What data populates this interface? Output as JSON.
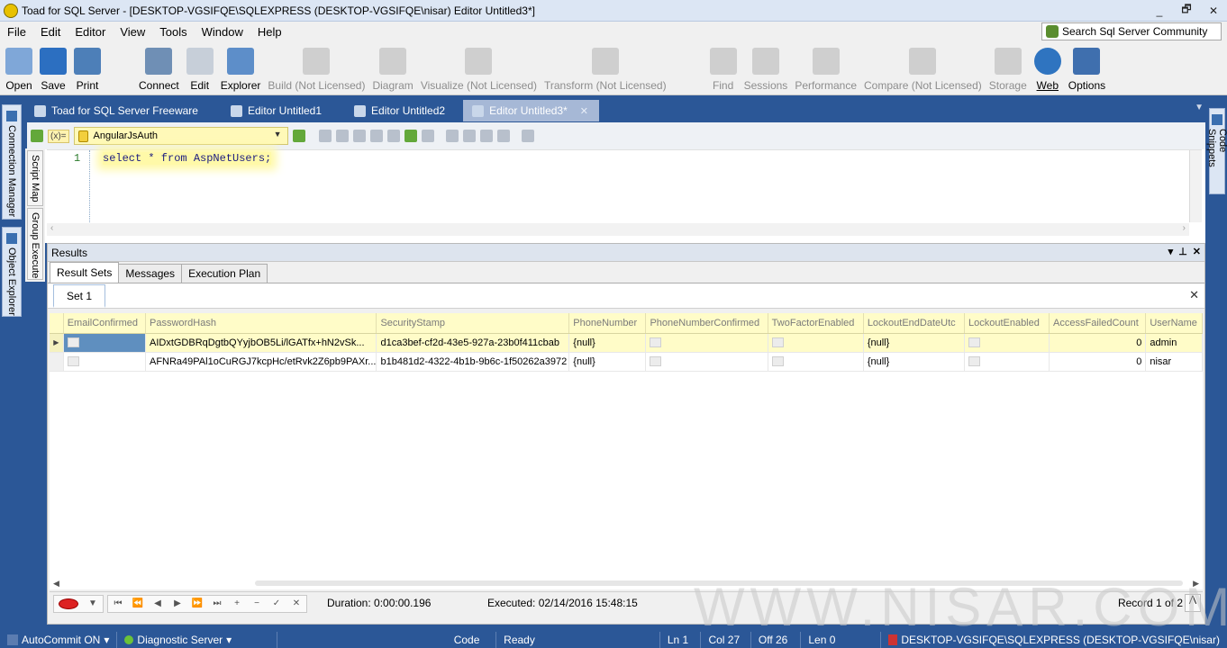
{
  "window": {
    "title": "Toad for SQL Server - [DESKTOP-VGSIFQE\\SQLEXPRESS (DESKTOP-VGSIFQE\\nisar) Editor Untitled3*]",
    "controls": [
      "_",
      "🗗",
      "✕"
    ]
  },
  "menu": {
    "items": [
      "File",
      "Edit",
      "Editor",
      "View",
      "Tools",
      "Window",
      "Help"
    ],
    "search_community": "Search Sql Server Community"
  },
  "toolbar": {
    "buttons": [
      {
        "label": "Open",
        "icon": "open-folder-icon",
        "enabled": true
      },
      {
        "label": "Save",
        "icon": "save-disk-icon",
        "enabled": true
      },
      {
        "label": "Print",
        "icon": "printer-icon",
        "enabled": true
      },
      {
        "label": "Connect",
        "icon": "plug-icon",
        "enabled": true
      },
      {
        "label": "Edit",
        "icon": "edit-document-icon",
        "enabled": true
      },
      {
        "label": "Explorer",
        "icon": "database-explorer-icon",
        "enabled": true
      },
      {
        "label": "Build (Not Licensed)",
        "icon": "build-icon",
        "enabled": false
      },
      {
        "label": "Diagram",
        "icon": "diagram-icon",
        "enabled": false
      },
      {
        "label": "Visualize (Not Licensed)",
        "icon": "visualize-icon",
        "enabled": false
      },
      {
        "label": "Transform (Not Licensed)",
        "icon": "transform-icon",
        "enabled": false
      },
      {
        "label": "Find",
        "icon": "find-icon",
        "enabled": false
      },
      {
        "label": "Sessions",
        "icon": "sessions-icon",
        "enabled": false
      },
      {
        "label": "Performance",
        "icon": "performance-icon",
        "enabled": false
      },
      {
        "label": "Compare (Not Licensed)",
        "icon": "compare-icon",
        "enabled": false
      },
      {
        "label": "Storage",
        "icon": "storage-icon",
        "enabled": false
      },
      {
        "label": "Web",
        "icon": "globe-icon",
        "enabled": true
      },
      {
        "label": "Options",
        "icon": "options-icon",
        "enabled": true
      }
    ]
  },
  "doc_tabs": [
    {
      "label": "Toad for SQL Server Freeware",
      "active": false
    },
    {
      "label": "Editor Untitled1",
      "active": false
    },
    {
      "label": "Editor Untitled2",
      "active": false
    },
    {
      "label": "Editor Untitled3*",
      "active": true
    }
  ],
  "side_panels": {
    "left": [
      "Connection Manager",
      "Object Explorer"
    ],
    "script": [
      "Script Map",
      "Group Execute"
    ],
    "right": [
      "Code Snippets"
    ]
  },
  "editor": {
    "connection": "AngularJsAuth",
    "variable_button": "(x)=",
    "line_number": "1",
    "sql": "select * from AspNetUsers;"
  },
  "results": {
    "panel_title": "Results",
    "tabs": [
      "Result Sets",
      "Messages",
      "Execution Plan"
    ],
    "active_tab": "Result Sets",
    "set_tab": "Set 1",
    "columns": [
      "EmailConfirmed",
      "PasswordHash",
      "SecurityStamp",
      "PhoneNumber",
      "PhoneNumberConfirmed",
      "TwoFactorEnabled",
      "LockoutEndDateUtc",
      "LockoutEnabled",
      "AccessFailedCount",
      "UserName"
    ],
    "rows": [
      {
        "PasswordHash": "AIDxtGDBRqDgtbQYyjbOB5Li/lGATfx+hN2vSk...",
        "SecurityStamp": "d1ca3bef-cf2d-43e5-927a-23b0f411cbab",
        "PhoneNumber": "{null}",
        "LockoutEndDateUtc": "{null}",
        "AccessFailedCount": "0",
        "UserName": "admin"
      },
      {
        "PasswordHash": "AFNRa49PAl1oCuRGJ7kcpHc/etRvk2Z6pb9PAXr...",
        "SecurityStamp": "b1b481d2-4322-4b1b-9b6c-1f50262a3972",
        "PhoneNumber": "{null}",
        "LockoutEndDateUtc": "{null}",
        "AccessFailedCount": "0",
        "UserName": "nisar"
      }
    ],
    "duration": "Duration: 0:00:00.196",
    "executed": "Executed: 02/14/2016 15:48:15",
    "record": "Record 1 of 2"
  },
  "watermark": "WWW.NISAR.COM",
  "statusbar": {
    "autocommit": "AutoCommit ON",
    "diagnostic": "Diagnostic Server",
    "mode": "Code",
    "state": "Ready",
    "ln": "Ln 1",
    "col": "Col 27",
    "off": "Off 26",
    "len": "Len 0",
    "connection": "DESKTOP-VGSIFQE\\SQLEXPRESS (DESKTOP-VGSIFQE\\nisar)"
  },
  "colors": {
    "frame": "#2b5797",
    "highlight": "#fffcc8",
    "active_tab": "#a6b8d6"
  }
}
